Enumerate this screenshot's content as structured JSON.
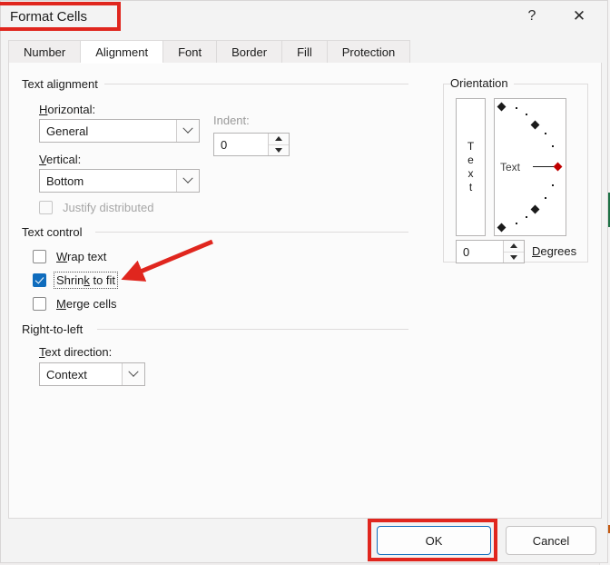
{
  "window": {
    "title": "Format Cells",
    "help_button": "?",
    "close_button": "✕"
  },
  "tabs": [
    {
      "label": "Number",
      "selected": false
    },
    {
      "label": "Alignment",
      "selected": true
    },
    {
      "label": "Font",
      "selected": false
    },
    {
      "label": "Border",
      "selected": false
    },
    {
      "label": "Fill",
      "selected": false
    },
    {
      "label": "Protection",
      "selected": false
    }
  ],
  "text_alignment": {
    "group_label": "Text alignment",
    "horizontal_label": "Horizontal:",
    "horizontal_value": "General",
    "vertical_label": "Vertical:",
    "vertical_value": "Bottom",
    "indent_label": "Indent:",
    "indent_value": "0",
    "justify_distributed_label": "Justify distributed",
    "justify_distributed_checked": false,
    "justify_distributed_disabled": true
  },
  "text_control": {
    "group_label": "Text control",
    "items": [
      {
        "label": "Wrap text",
        "checked": false,
        "focused": false
      },
      {
        "label": "Shrink to fit",
        "checked": true,
        "focused": true
      },
      {
        "label": "Merge cells",
        "checked": false,
        "focused": false
      }
    ]
  },
  "right_to_left": {
    "group_label": "Right-to-left",
    "text_direction_label": "Text direction:",
    "text_direction_value": "Context"
  },
  "orientation": {
    "group_label": "Orientation",
    "vertical_text_letters": [
      "T",
      "e",
      "x",
      "t"
    ],
    "dial_text": "Text",
    "degrees_value": "0",
    "degrees_label": "Degrees",
    "degrees_selected": 0
  },
  "footer": {
    "ok_label": "OK",
    "cancel_label": "Cancel"
  },
  "annotations": {
    "accent_color": "#e0261e",
    "title_highlight": "Format Cells",
    "ok_highlight": "OK",
    "arrow_target": "Shrink to fit"
  },
  "colors": {
    "accent_blue": "#0f6cbd",
    "annotation_red": "#e0261e",
    "dial_active_red": "#c00000"
  }
}
